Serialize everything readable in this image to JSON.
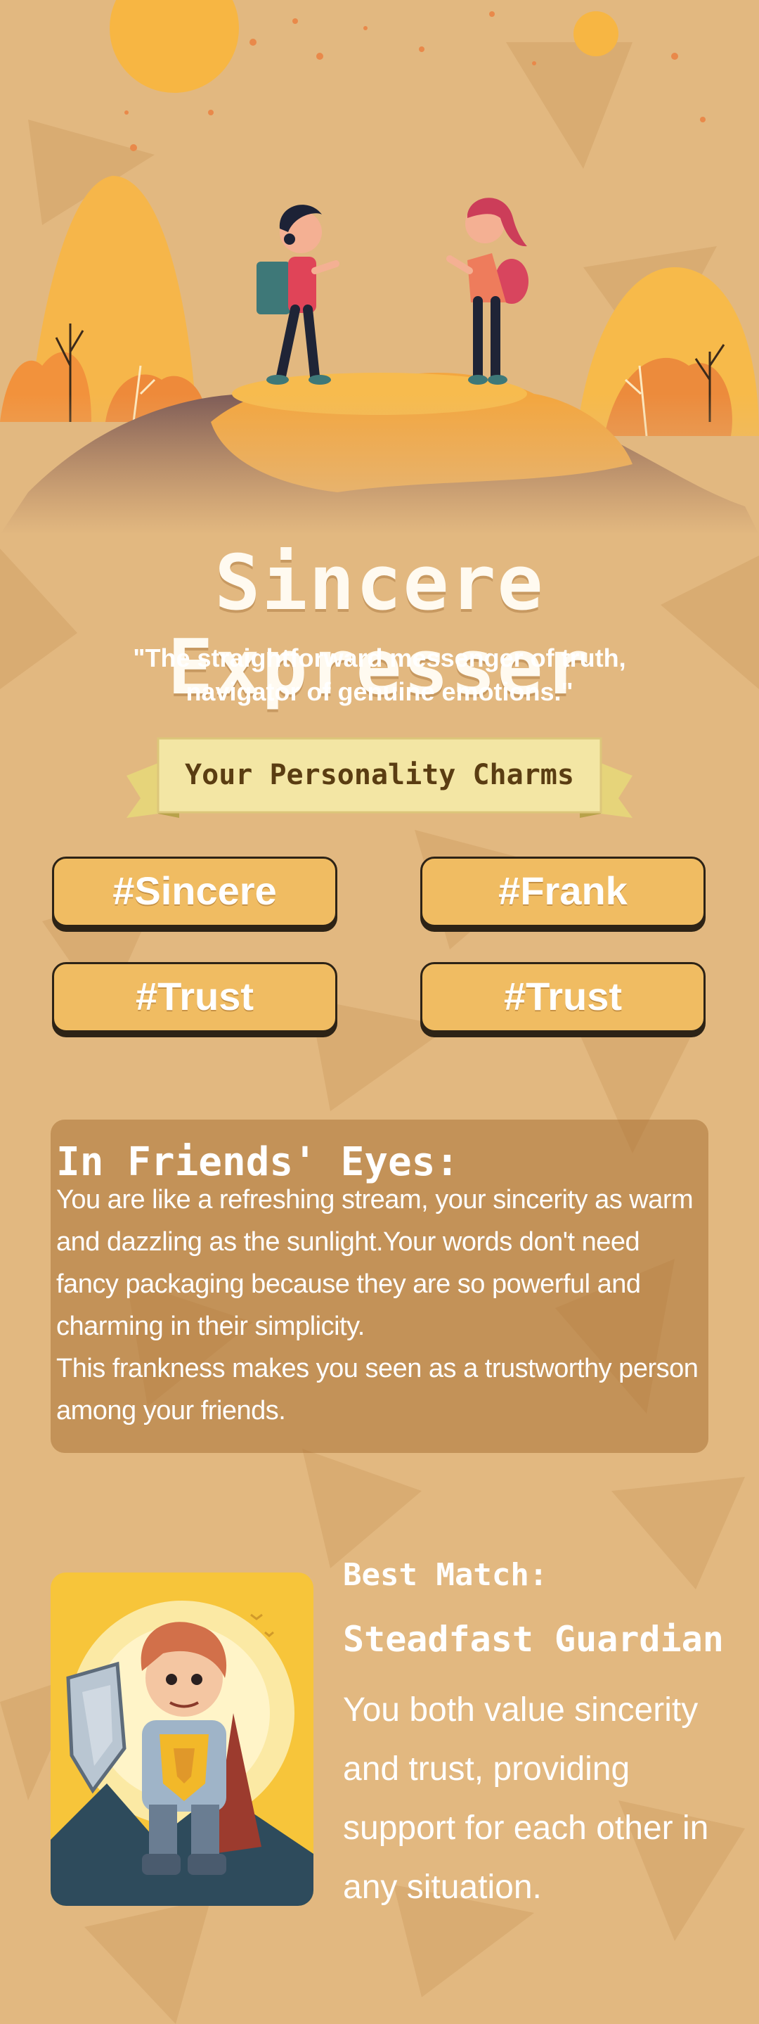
{
  "hero": {
    "illustration": "two-friends-on-hill-illustration"
  },
  "title": "Sincere Expresser",
  "subtitle": "\"The straightforward messenger of truth, navigator of genuine emotions.\"",
  "charms_heading": "Your Personality Charms",
  "tags": [
    "#Sincere",
    "#Frank",
    "#Trust",
    "#Trust"
  ],
  "friends_eyes": {
    "title": "In Friends' Eyes:",
    "paragraph1": "You are like a refreshing stream, your sincerity as warm and dazzling as the sunlight.Your words don't need fancy packaging because they are so powerful and charming in their simplicity.",
    "paragraph2": "This frankness makes you seen as a trustworthy person among your friends."
  },
  "best_match": {
    "label": "Best Match:",
    "name": "Steadfast Guardian",
    "description": "You both value sincerity and trust, providing support for each other in any situation.",
    "image": "knight-guardian-illustration"
  },
  "colors": {
    "background": "#e2b880",
    "tag_fill": "#f0bc62",
    "tag_border": "#2d2316",
    "ribbon": "#f3e6a4",
    "ribbon_text": "#5a3d12"
  }
}
